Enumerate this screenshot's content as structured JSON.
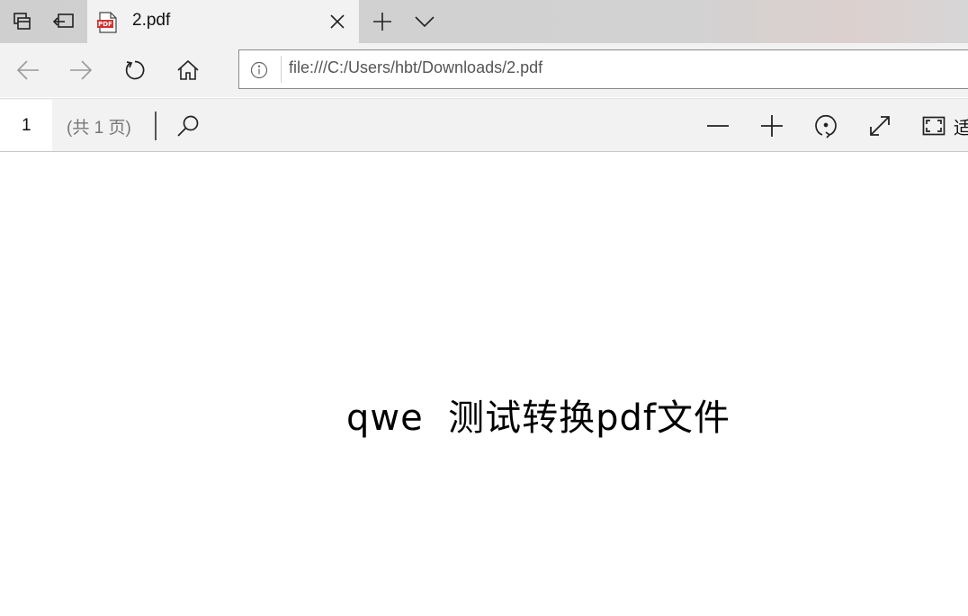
{
  "tabstrip": {
    "tab_title": "2.pdf",
    "pdf_icon_label": "PDF"
  },
  "navbar": {
    "url": "file:///C:/Users/hbt/Downloads/2.pdf"
  },
  "pdf_toolbar": {
    "page_number": "1",
    "page_count": "(共 1 页)",
    "fit_label": "适"
  },
  "document": {
    "text": "qwe  测试转换pdf文件"
  },
  "colors": {
    "pdf_icon_red": "#d32f2f",
    "tabstrip_bg": "#d2d2d2",
    "toolbar_bg": "#f2f2f2"
  }
}
